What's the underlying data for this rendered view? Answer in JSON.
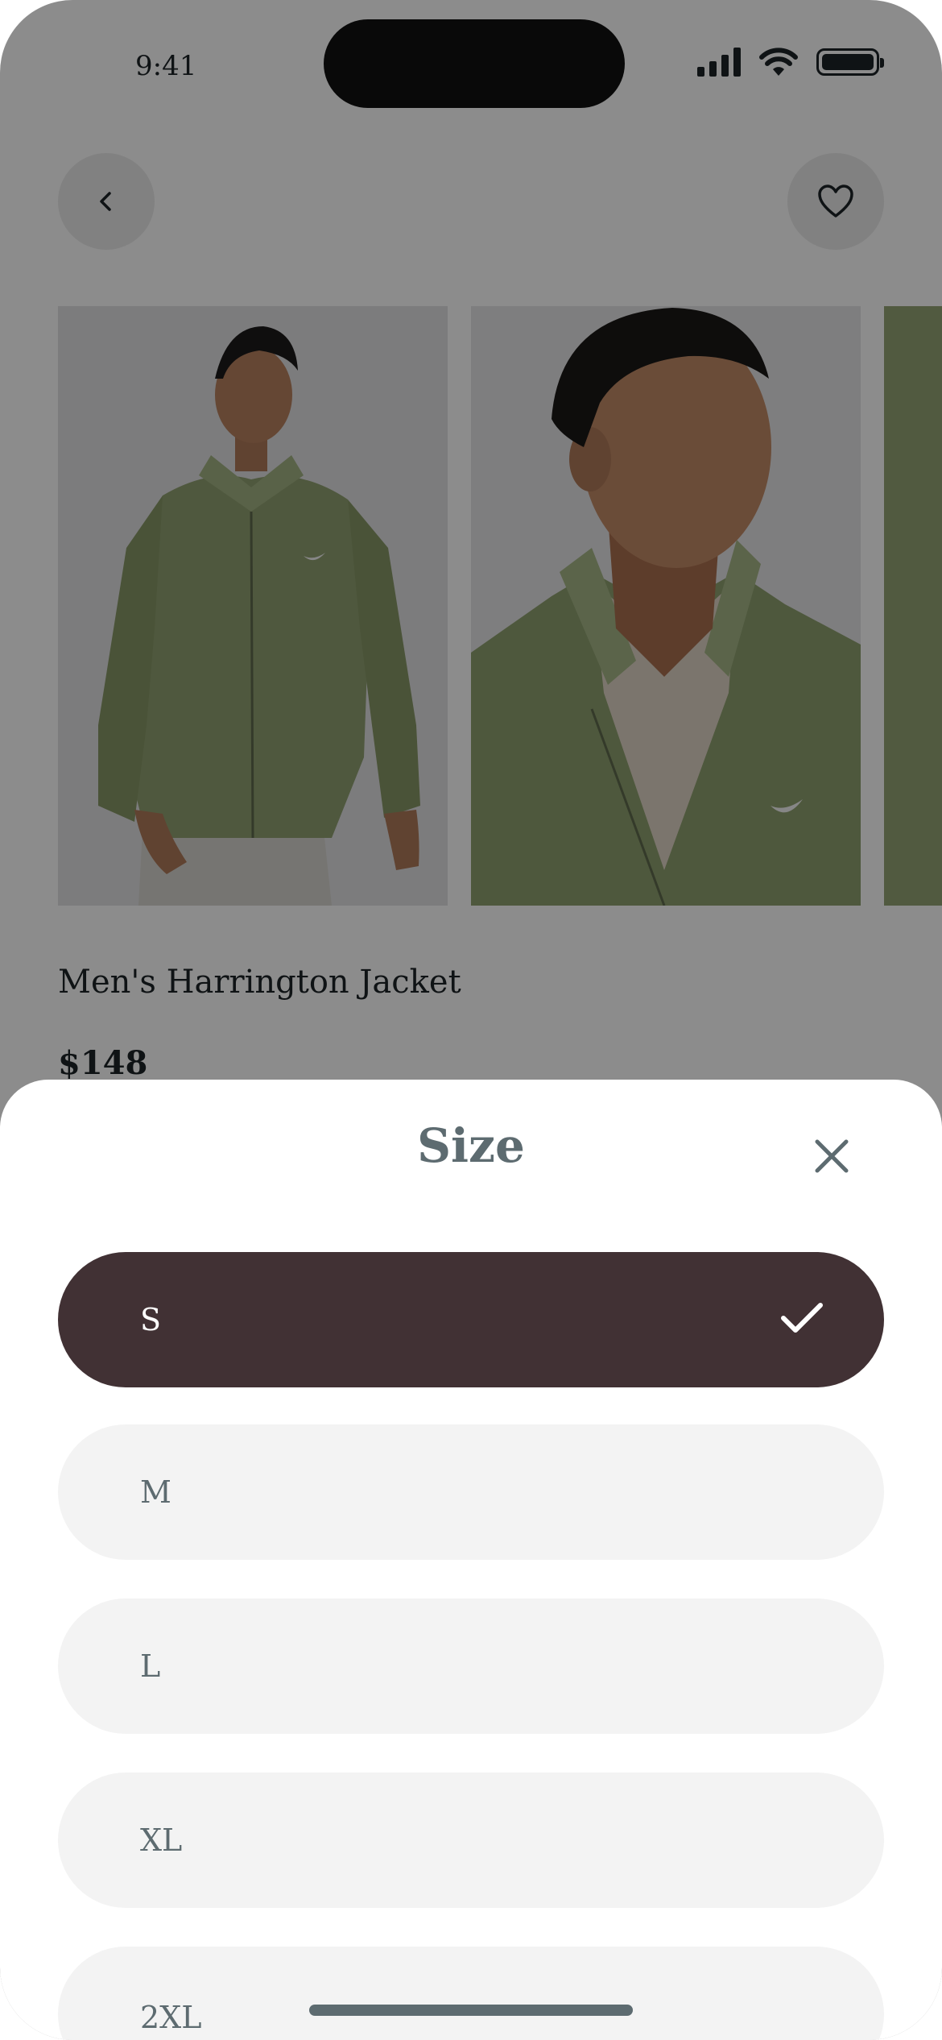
{
  "status_bar": {
    "time": "9:41"
  },
  "header": {
    "back_icon": "chevron-left-icon",
    "favorite_icon": "heart-icon"
  },
  "gallery": {
    "images": [
      {
        "description": "model-wearing-green-jacket-full"
      },
      {
        "description": "model-closeup-collar"
      },
      {
        "description": "fabric-closeup"
      }
    ]
  },
  "product": {
    "name": "Men's Harrington Jacket",
    "price": "$148"
  },
  "size_sheet": {
    "title": "Size",
    "close_icon": "close-icon",
    "options": [
      {
        "label": "S",
        "selected": true
      },
      {
        "label": "M",
        "selected": false
      },
      {
        "label": "L",
        "selected": false
      },
      {
        "label": "XL",
        "selected": false
      },
      {
        "label": "2XL",
        "selected": false
      }
    ]
  },
  "colors": {
    "selected_option": "#413134",
    "option_bg": "#f3f3f3",
    "text_muted": "#5d6b70",
    "jacket_green": "#8fa06f"
  }
}
